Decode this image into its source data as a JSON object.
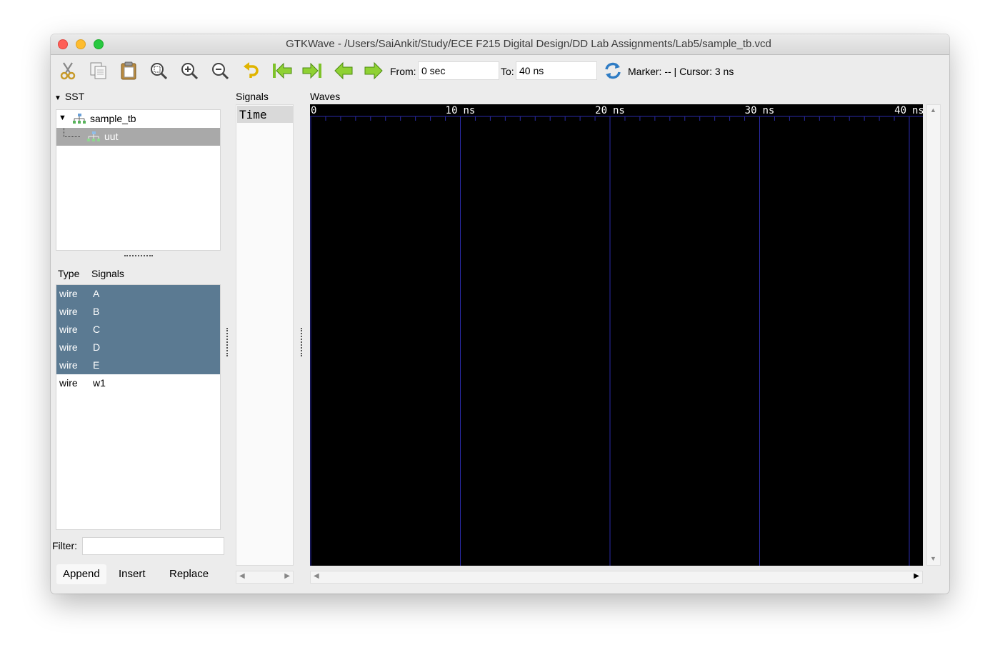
{
  "window": {
    "title": "GTKWave - /Users/SaiAnkit/Study/ECE F215 Digital Design/DD Lab Assignments/Lab5/sample_tb.vcd"
  },
  "toolbar": {
    "icons": [
      "cut-icon",
      "copy-icon",
      "paste-icon",
      "zoom-fit-icon",
      "zoom-in-icon",
      "zoom-out-icon",
      "undo-zoom-icon",
      "go-start-icon",
      "go-end-icon",
      "prev-edge-icon",
      "next-edge-icon",
      "reload-icon"
    ],
    "from_label": "From:",
    "from_value": "0 sec",
    "to_label": "To:",
    "to_value": "40 ns",
    "status": "Marker: --  |  Cursor: 3 ns"
  },
  "sst": {
    "title": "SST",
    "tree": [
      {
        "label": "sample_tb",
        "selected": false
      },
      {
        "label": "uut",
        "selected": true
      }
    ]
  },
  "signal_list": {
    "type_header": "Type",
    "signals_header": "Signals",
    "rows": [
      {
        "type": "wire",
        "name": "A",
        "selected": true
      },
      {
        "type": "wire",
        "name": "B",
        "selected": true
      },
      {
        "type": "wire",
        "name": "C",
        "selected": true
      },
      {
        "type": "wire",
        "name": "D",
        "selected": true
      },
      {
        "type": "wire",
        "name": "E",
        "selected": true
      },
      {
        "type": "wire",
        "name": "w1",
        "selected": false
      }
    ]
  },
  "filter": {
    "label": "Filter:",
    "value": ""
  },
  "buttons": {
    "append": "Append",
    "insert": "Insert",
    "replace": "Replace"
  },
  "signals_pane": {
    "title": "Signals",
    "time_label": "Time"
  },
  "waves": {
    "title": "Waves",
    "tick_labels": [
      "0",
      "10 ns",
      "20 ns",
      "30 ns",
      "40 ns"
    ],
    "background": "#000000",
    "grid_color": "#2a2aa8"
  }
}
